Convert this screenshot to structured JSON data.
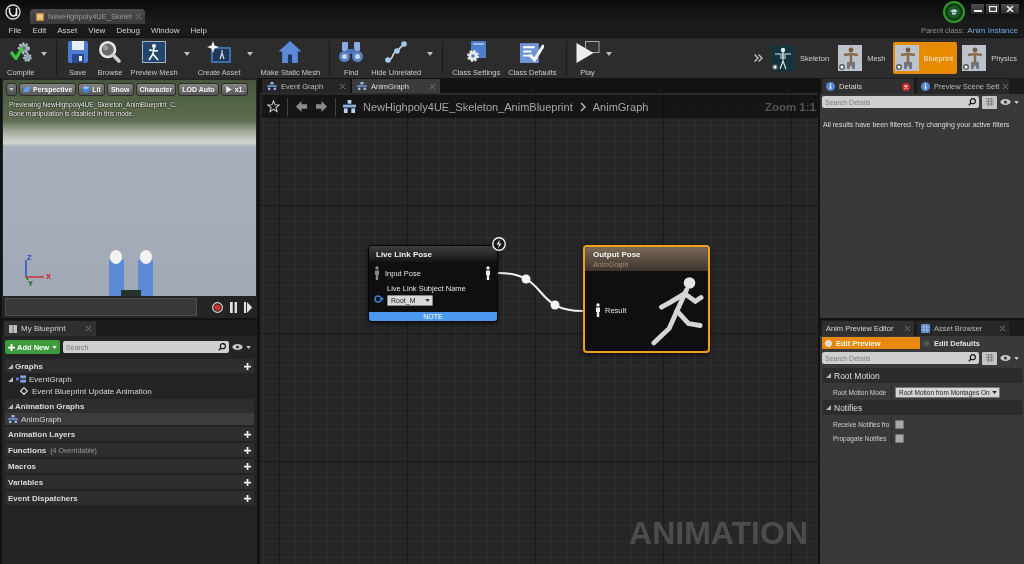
{
  "window": {
    "tab": "NewHighpoly4UE_Skelet"
  },
  "menu": [
    "File",
    "Edit",
    "Asset",
    "View",
    "Debug",
    "Window",
    "Help"
  ],
  "parent_class": {
    "label": "Parent class:",
    "value": "Anim Instance"
  },
  "toolbar": [
    [
      {
        "label": "Compile",
        "dropdown": true
      }
    ],
    [
      {
        "label": "Save",
        "dropdown": false
      },
      {
        "label": "Browse",
        "dropdown": false
      },
      {
        "label": "Preview Mesh",
        "dropdown": true
      },
      {
        "label": "Create Asset",
        "dropdown": true
      },
      {
        "label": "Make Static Mesh",
        "dropdown": false
      }
    ],
    [
      {
        "label": "Find",
        "dropdown": false
      },
      {
        "label": "Hide Unrelated",
        "dropdown": true
      }
    ],
    [
      {
        "label": "Class Settings",
        "dropdown": false
      },
      {
        "label": "Class Defaults",
        "dropdown": false
      }
    ],
    [
      {
        "label": "Play",
        "dropdown": true
      }
    ]
  ],
  "modes": [
    {
      "label": "Skeleton",
      "selected": false
    },
    {
      "label": "Mesh",
      "selected": false
    },
    {
      "label": "Blueprint",
      "selected": true
    },
    {
      "label": "Physics",
      "selected": false
    }
  ],
  "viewport": {
    "buttons": [
      "Perspective",
      "Lit",
      "Show",
      "Character",
      "LOD Auto",
      "x1."
    ],
    "info": [
      "Previewing NewHighpoly4UE_Skeleton_AnimBlueprint_C.",
      "Bone manipulation is disabled in this mode."
    ],
    "axes": [
      "Z",
      "X",
      "Y"
    ]
  },
  "my_blueprint": {
    "tab": "My Blueprint",
    "add_new": "Add New",
    "search": {
      "placeholder": "Search"
    },
    "sections": [
      {
        "label": "Graphs",
        "expanded": true,
        "addable": true,
        "selected": false,
        "children": [
          {
            "label": "EventGraph",
            "kind": "graph",
            "expanded": true,
            "selected": false,
            "children": [
              {
                "label": "Event Blueprint Update Animation",
                "kind": "event",
                "selected": false
              }
            ]
          }
        ]
      },
      {
        "label": "Animation Graphs",
        "expanded": true,
        "addable": false,
        "selected": false,
        "children": [
          {
            "label": "AnimGraph",
            "kind": "animgraph",
            "selected": true
          }
        ]
      },
      {
        "label": "Animation Layers",
        "expanded": false,
        "addable": true,
        "selected": false
      },
      {
        "label": "Functions",
        "note": "(4 Overridable)",
        "expanded": false,
        "addable": true,
        "selected": false
      },
      {
        "label": "Macros",
        "expanded": false,
        "addable": true,
        "selected": false
      },
      {
        "label": "Variables",
        "expanded": false,
        "addable": true,
        "selected": false
      },
      {
        "label": "Event Dispatchers",
        "expanded": false,
        "addable": true,
        "selected": false
      }
    ]
  },
  "graph": {
    "tabs": [
      {
        "label": "Event Graph",
        "selected": false
      },
      {
        "label": "AnimGraph",
        "selected": true
      }
    ],
    "breadcrumb": [
      "NewHighpoly4UE_Skeleton_AnimBlueprint",
      "AnimGraph"
    ],
    "zoom": "Zoom 1:1",
    "nodes": [
      {
        "kind": "live_link",
        "title": "Live Link Pose",
        "selected": false,
        "input_pin": "Input Pose",
        "property": "Live Link Subject Name",
        "value": "Root_M",
        "footer": "NOTE"
      },
      {
        "kind": "output",
        "title": "Output Pose",
        "subtitle": "AnimGraph",
        "selected": true,
        "input_pin": "Result"
      }
    ],
    "type_label": "ANIMATION"
  },
  "details": {
    "tabs": [
      {
        "label": "Details",
        "selected": true
      },
      {
        "label": "Preview Scene Sett",
        "selected": false
      }
    ],
    "search": {
      "placeholder": "Search Details"
    },
    "message": "All results have been filtered. Try changing your active filters"
  },
  "anim_preview": {
    "tabs": [
      {
        "label": "Anim Preview Editor",
        "selected": true
      },
      {
        "label": "Asset Browser",
        "selected": false
      }
    ],
    "modes": [
      {
        "label": "Edit Preview",
        "selected": true
      },
      {
        "label": "Edit Defaults",
        "selected": false
      }
    ],
    "search": {
      "placeholder": "Search Details"
    },
    "categories": [
      {
        "label": "Root Motion",
        "expanded": true,
        "properties": [
          {
            "label": "Root Motion Mode",
            "kind": "dropdown",
            "value": "Root Motion from Montages On"
          }
        ]
      },
      {
        "label": "Notifies",
        "expanded": true,
        "properties": [
          {
            "label": "Receive Notifies fro",
            "kind": "checkbox",
            "checked": false
          },
          {
            "label": "Propagate Notifies",
            "kind": "checkbox",
            "checked": false
          }
        ]
      }
    ]
  }
}
